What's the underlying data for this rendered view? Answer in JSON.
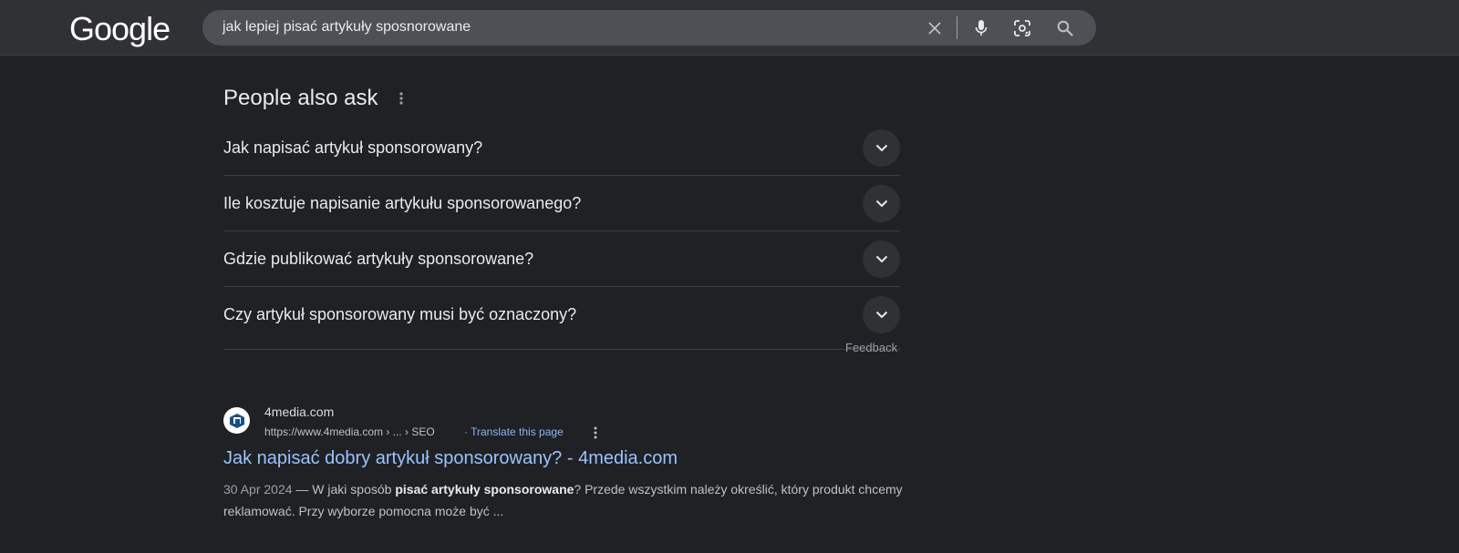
{
  "header": {
    "logo_text": "Google",
    "search": {
      "query": "jak lepiej pisać artykuły sposnorowane",
      "icons": [
        "clear-icon",
        "microphone-icon",
        "lens-icon",
        "search-icon"
      ]
    }
  },
  "people_also_ask": {
    "title": "People also ask",
    "questions": [
      "Jak napisać artykuł sponsorowany?",
      "Ile kosztuje napisanie artykułu sponsorowanego?",
      "Gdzie publikować artykuły sponsorowane?",
      "Czy artykuł sponsorowany musi być oznaczony?"
    ],
    "feedback_label": "Feedback"
  },
  "result": {
    "site_name": "4media.com",
    "url": "https://www.4media.com › ... › SEO",
    "separator": "·",
    "translate_label": "Translate this page",
    "title": "Jak napisać dobry artykuł sponsorowany? - 4media.com",
    "date": "30 Apr 2024",
    "dash": " — ",
    "snippet_part1": "W jaki sposób ",
    "snippet_bold": "pisać artykuły sponsorowane",
    "snippet_part2": "? Przede wszystkim należy określić, który produkt chcemy reklamować. Przy wyborze pomocna może być ..."
  },
  "colors": {
    "background": "#202124",
    "topbar": "#303134",
    "link": "#99c3ff",
    "accent_link": "#8ab4f8"
  }
}
